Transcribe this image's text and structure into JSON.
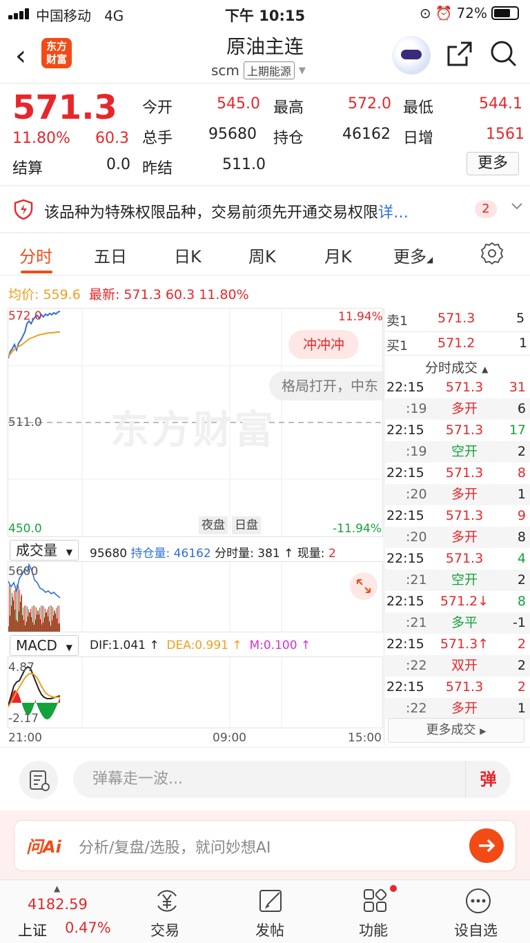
{
  "status": {
    "carrier": "中国移动",
    "network": "4G",
    "time": "下午 10:15",
    "battery": "72%"
  },
  "nav": {
    "logo_line1": "东方",
    "logo_line2": "财富",
    "title": "原油主连",
    "code": "scm",
    "exchange": "上期能源"
  },
  "quote": {
    "price": "571.3",
    "change_pct": "11.80%",
    "change": "60.3",
    "open_label": "今开",
    "open": "545.0",
    "high_label": "最高",
    "high": "572.0",
    "low_label": "最低",
    "low": "544.1",
    "volume_label": "总手",
    "volume": "95680",
    "oi_label": "持仓",
    "oi": "46162",
    "daily_inc_label": "日增",
    "daily_inc": "1561",
    "settle_label": "结算",
    "settle": "0.0",
    "prev_settle_label": "昨结",
    "prev_settle": "511.0",
    "more_label": "更多"
  },
  "notice": {
    "text": "该品种为特殊权限品种，交易前须先开通交易权限",
    "link": "详…",
    "badge": "2"
  },
  "tabs": [
    "分时",
    "五日",
    "日K",
    "周K",
    "月K",
    "更多"
  ],
  "header_line": {
    "avg_label": "均价:",
    "avg": "559.6",
    "latest_label": "最新:",
    "latest": "571.3",
    "change": "60.3",
    "pct": "11.80%"
  },
  "price_chart": {
    "y_top": "572.0",
    "y_mid": "511.0",
    "y_bottom": "450.0",
    "pct_top": "11.94%",
    "pct_bottom": "-11.94%",
    "session_night": "夜盘",
    "session_day": "日盘",
    "watermark": "东方财富",
    "bubble": "冲冲冲",
    "danmu": "格局打开，中东"
  },
  "volume_panel": {
    "selector": "成交量",
    "total": "95680",
    "oi_label": "持仓量:",
    "oi": "46162",
    "tick_label": "分时量:",
    "tick": "381 ↑",
    "now_label": "现量:",
    "now": "2",
    "y_top": "5600"
  },
  "macd_panel": {
    "selector": "MACD",
    "dif": "DIF:1.041 ↑",
    "dea": "DEA:0.991 ↑",
    "m": "M:0.100 ↑",
    "y_top": "4.87",
    "y_bottom": "-2.17"
  },
  "time_axis": [
    "21:00",
    "09:00",
    "15:00"
  ],
  "order_book": {
    "ask_label": "卖1",
    "ask_price": "571.3",
    "ask_vol": "5",
    "bid_label": "买1",
    "bid_price": "571.2",
    "bid_vol": "1",
    "tick_header": "分时成交"
  },
  "trades": [
    {
      "t": "22:15",
      "p": "571.3",
      "v": "31",
      "pc": "red",
      "vc": "red"
    },
    {
      "t": ":19",
      "p": "多开",
      "v": "6",
      "pc": "red",
      "vc": "dark"
    },
    {
      "t": "22:15",
      "p": "571.3",
      "v": "17",
      "pc": "red",
      "vc": "green"
    },
    {
      "t": ":19",
      "p": "空开",
      "v": "2",
      "pc": "green",
      "vc": "dark"
    },
    {
      "t": "22:15",
      "p": "571.3",
      "v": "8",
      "pc": "red",
      "vc": "red"
    },
    {
      "t": ":20",
      "p": "多开",
      "v": "1",
      "pc": "red",
      "vc": "dark"
    },
    {
      "t": "22:15",
      "p": "571.3",
      "v": "9",
      "pc": "red",
      "vc": "red"
    },
    {
      "t": ":20",
      "p": "多开",
      "v": "8",
      "pc": "red",
      "vc": "dark"
    },
    {
      "t": "22:15",
      "p": "571.3",
      "v": "4",
      "pc": "red",
      "vc": "green"
    },
    {
      "t": ":21",
      "p": "空开",
      "v": "2",
      "pc": "green",
      "vc": "dark"
    },
    {
      "t": "22:15",
      "p": "571.2↓",
      "v": "8",
      "pc": "red",
      "vc": "green"
    },
    {
      "t": ":21",
      "p": "多平",
      "v": "-1",
      "pc": "green",
      "vc": "dark"
    },
    {
      "t": "22:15",
      "p": "571.3↑",
      "v": "2",
      "pc": "red",
      "vc": "red"
    },
    {
      "t": ":22",
      "p": "双开",
      "v": "2",
      "pc": "red",
      "vc": "dark"
    },
    {
      "t": "22:15",
      "p": "571.3",
      "v": "2",
      "pc": "red",
      "vc": "red"
    },
    {
      "t": ":22",
      "p": "多开",
      "v": "1",
      "pc": "red",
      "vc": "dark"
    }
  ],
  "more_trades": "更多成交",
  "comment": {
    "placeholder": "弹幕走一波...",
    "danmu_button": "弹"
  },
  "ai": {
    "logo": "问Ai",
    "placeholder": "分析/复盘/选股，就问妙想AI"
  },
  "bottom_nav": {
    "index_value": "4182.59",
    "index_name": "上证",
    "index_pct": "0.47%",
    "trade": "交易",
    "post": "发帖",
    "func": "功能",
    "watch": "设自选"
  },
  "colors": {
    "up": "#e8262a",
    "down": "#14a33a",
    "brand": "#f24b16",
    "avg": "#f29e1d"
  }
}
